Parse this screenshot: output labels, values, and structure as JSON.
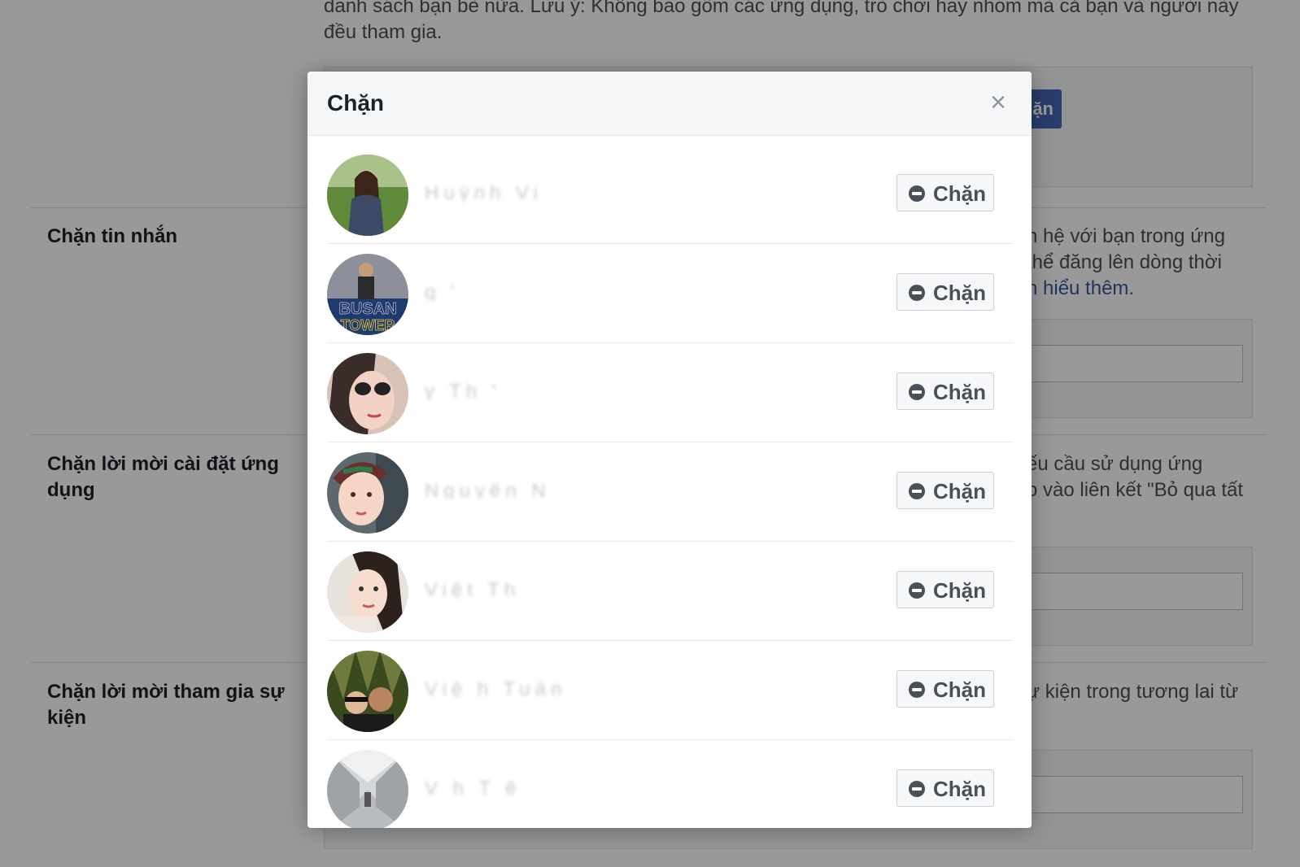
{
  "background": {
    "intro_text": "danh sách bạn bè nữa. Lưu ý: Không bao gồm các ứng dụng, trò chơi hay nhóm mà cả bạn và người này đều tham gia.",
    "top_button_label": "ặn",
    "sections": [
      {
        "title": "Chặn tin nhắn",
        "desc_line1": "n hệ với bạn trong ứng",
        "desc_line2": "thể đăng lên dòng thời",
        "desc_link": "n hiểu thêm."
      },
      {
        "title": "Chặn lời mời cài đặt ứng dụng",
        "desc_line1": "ếu cầu sử dụng ứng",
        "desc_line2": "o vào liên kết \"Bỏ qua tất"
      },
      {
        "title": "Chặn lời mời tham gia sự kiện",
        "desc_line1": "ự kiện trong tương lai từ"
      }
    ]
  },
  "modal": {
    "title": "Chặn",
    "close_icon": "×",
    "button_label": "Chặn",
    "people": [
      {
        "name": "Huỳnh Vi",
        "avatar": "woman-grass"
      },
      {
        "name": "  g  '",
        "avatar": "busan-tower"
      },
      {
        "name": "  y Th  '",
        "avatar": "sunglasses"
      },
      {
        "name": "Nguyễn N",
        "avatar": "headband"
      },
      {
        "name": "Việt Th",
        "avatar": "selfie"
      },
      {
        "name": "Việ  h Tuấn",
        "avatar": "couple"
      },
      {
        "name": "V  h T ề",
        "avatar": "hallway"
      }
    ]
  }
}
